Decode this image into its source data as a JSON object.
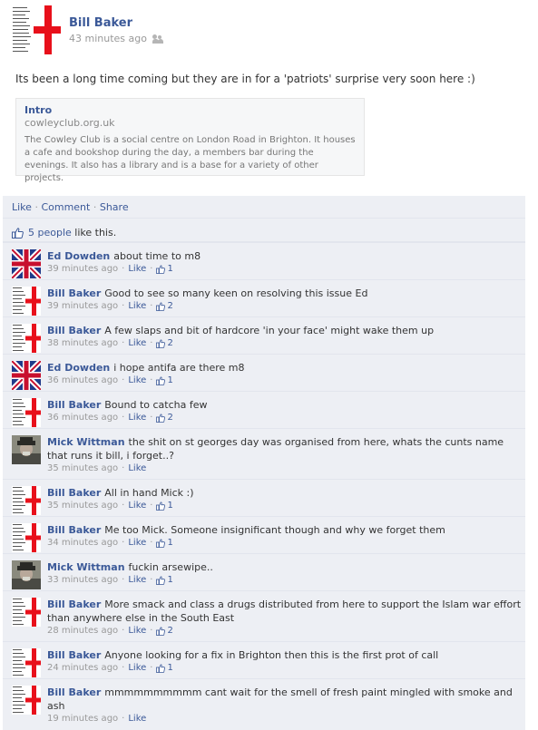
{
  "post": {
    "author": "Bill Baker",
    "time": "43 minutes ago",
    "text": "Its been a long time coming but they are in for a 'patriots' surprise very soon here :)",
    "link": {
      "title": "Intro",
      "domain": "cowleyclub.org.uk",
      "description": "The Cowley Club is a social centre on London Road in Brighton. It houses a cafe and bookshop during the day, a members bar during the evenings. It also has a library and is a base for a variety of other projects."
    }
  },
  "actions": {
    "like": "Like",
    "comment": "Comment",
    "share": "Share",
    "sep": "·"
  },
  "likes": {
    "people": "5 people",
    "suffix": "like this."
  },
  "comments": [
    {
      "author": "Ed Dowden",
      "text": "about time to m8",
      "time": "39 minutes ago",
      "like": "Like",
      "count": "1",
      "avatar": "union-jack"
    },
    {
      "author": "Bill Baker",
      "text": "Good to see so many keen on resolving this issue Ed",
      "time": "39 minutes ago",
      "like": "Like",
      "count": "2",
      "avatar": "cross"
    },
    {
      "author": "Bill Baker",
      "text": "A few slaps and bit of hardcore 'in your face' might wake them up",
      "time": "38 minutes ago",
      "like": "Like",
      "count": "2",
      "avatar": "cross"
    },
    {
      "author": "Ed Dowden",
      "text": "i hope antifa are there m8",
      "time": "36 minutes ago",
      "like": "Like",
      "count": "1",
      "avatar": "union-jack"
    },
    {
      "author": "Bill Baker",
      "text": "Bound to catcha few",
      "time": "36 minutes ago",
      "like": "Like",
      "count": "2",
      "avatar": "cross"
    },
    {
      "author": "Mick Wittman",
      "text": "the shit on st georges day was organised from here, whats the cunts name that runs it bill, i forget..?",
      "time": "35 minutes ago",
      "like": "Like",
      "count": "",
      "avatar": "photo"
    },
    {
      "author": "Bill Baker",
      "text": "All in hand Mick :)",
      "time": "35 minutes ago",
      "like": "Like",
      "count": "1",
      "avatar": "cross"
    },
    {
      "author": "Bill Baker",
      "text": "Me too Mick. Someone insignificant though and why we forget them",
      "time": "34 minutes ago",
      "like": "Like",
      "count": "1",
      "avatar": "cross"
    },
    {
      "author": "Mick Wittman",
      "text": "fuckin arsewipe..",
      "time": "33 minutes ago",
      "like": "Like",
      "count": "1",
      "avatar": "photo"
    },
    {
      "author": "Bill Baker",
      "text": "More smack and class a drugs distributed from here to support the Islam war effort than anywhere else in the South East",
      "time": "28 minutes ago",
      "like": "Like",
      "count": "2",
      "avatar": "cross"
    },
    {
      "author": "Bill Baker",
      "text": "Anyone looking for a fix in Brighton then this is the first prot of call",
      "time": "24 minutes ago",
      "like": "Like",
      "count": "1",
      "avatar": "cross"
    },
    {
      "author": "Bill Baker",
      "text": "mmmmmmmmmm cant wait for the smell of fresh paint mingled with smoke and ash",
      "time": "19 minutes ago",
      "like": "Like",
      "count": "",
      "avatar": "cross"
    }
  ],
  "colors": {
    "link": "#3b5998",
    "feedback_bg": "#edeff4",
    "cross_red": "#e8101b"
  }
}
